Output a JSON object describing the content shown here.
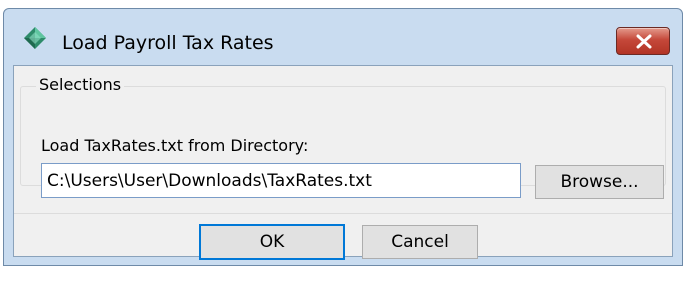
{
  "window": {
    "title": "Load Payroll Tax Rates",
    "icon": "green-diamond-icon",
    "close_icon": "close-icon"
  },
  "selections": {
    "group_label": "Selections",
    "directory_label": "Load TaxRates.txt from Directory:",
    "path_value": "C:\\Users\\User\\Downloads\\TaxRates.txt",
    "browse_label": "Browse..."
  },
  "buttons": {
    "ok_label": "OK",
    "cancel_label": "Cancel"
  },
  "colors": {
    "title_bar": "#c9dcf0",
    "close_button": "#c5483a",
    "dialog_background": "#f0f0f0",
    "default_button_border": "#0078d7"
  }
}
